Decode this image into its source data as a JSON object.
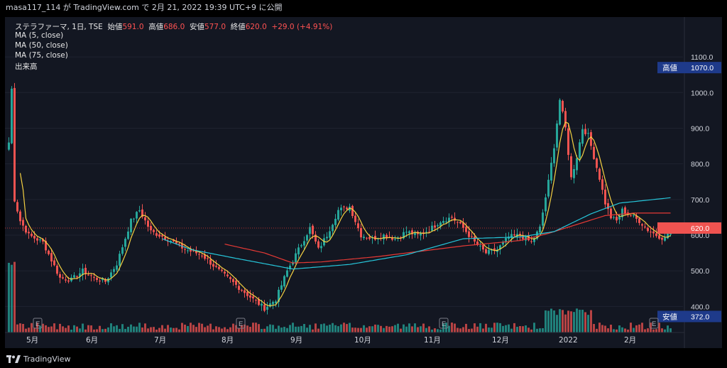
{
  "header": {
    "caption": "masa117_114 が TradingView.com で 2月 21, 2022 19:39 UTC+9 に公開"
  },
  "legend": {
    "symbol": "ステラファーマ, 1日, TSE",
    "open_label": "始値",
    "open": "591.0",
    "high_label": "高値",
    "high": "686.0",
    "low_label": "安値",
    "low": "577.0",
    "close_label": "終値",
    "close": "620.0",
    "change": "+29.0 (+4.91%)",
    "ma5": "MA (5, close)",
    "ma50": "MA (50, close)",
    "ma75": "MA (75, close)",
    "volume": "出来高"
  },
  "price_labels": {
    "high_label": "高値",
    "high_value": "1070.0",
    "low_label": "安値",
    "low_value": "372.0",
    "last_value": "620.0"
  },
  "footer": {
    "brand": "TradingView"
  },
  "colors": {
    "up": "#26a69a",
    "down": "#ef5350",
    "ma5": "#f5d142",
    "ma50": "#e53935",
    "ma75": "#26c6da",
    "background": "#131722"
  },
  "chart_data": {
    "type": "candlestick",
    "y_axis": {
      "ticks": [
        400,
        500,
        600,
        700,
        800,
        900,
        1000,
        1100
      ],
      "range": [
        355,
        1140
      ]
    },
    "x_axis_labels": [
      "5月",
      "6月",
      "7月",
      "8月",
      "9月",
      "10月",
      "11月",
      "12月",
      "2022",
      "2月"
    ],
    "earnings_markers": [
      "E",
      "E",
      "E",
      "E"
    ],
    "price_anchors": [
      {
        "t": 0,
        "p": 860
      },
      {
        "t": 1,
        "p": 1010
      },
      {
        "t": 2,
        "p": 700
      },
      {
        "t": 4,
        "p": 640
      },
      {
        "t": 7,
        "p": 600
      },
      {
        "t": 12,
        "p": 580
      },
      {
        "t": 18,
        "p": 480
      },
      {
        "t": 22,
        "p": 475
      },
      {
        "t": 26,
        "p": 500
      },
      {
        "t": 30,
        "p": 480
      },
      {
        "t": 34,
        "p": 470
      },
      {
        "t": 38,
        "p": 520
      },
      {
        "t": 43,
        "p": 640
      },
      {
        "t": 46,
        "p": 670
      },
      {
        "t": 50,
        "p": 610
      },
      {
        "t": 56,
        "p": 590
      },
      {
        "t": 62,
        "p": 560
      },
      {
        "t": 68,
        "p": 545
      },
      {
        "t": 74,
        "p": 500
      },
      {
        "t": 80,
        "p": 460
      },
      {
        "t": 86,
        "p": 420
      },
      {
        "t": 90,
        "p": 395
      },
      {
        "t": 94,
        "p": 420
      },
      {
        "t": 98,
        "p": 500
      },
      {
        "t": 102,
        "p": 560
      },
      {
        "t": 106,
        "p": 620
      },
      {
        "t": 109,
        "p": 560
      },
      {
        "t": 112,
        "p": 600
      },
      {
        "t": 116,
        "p": 670
      },
      {
        "t": 120,
        "p": 680
      },
      {
        "t": 124,
        "p": 600
      },
      {
        "t": 128,
        "p": 590
      },
      {
        "t": 132,
        "p": 600
      },
      {
        "t": 136,
        "p": 590
      },
      {
        "t": 140,
        "p": 610
      },
      {
        "t": 144,
        "p": 600
      },
      {
        "t": 148,
        "p": 615
      },
      {
        "t": 152,
        "p": 640
      },
      {
        "t": 156,
        "p": 650
      },
      {
        "t": 160,
        "p": 620
      },
      {
        "t": 164,
        "p": 580
      },
      {
        "t": 168,
        "p": 550
      },
      {
        "t": 172,
        "p": 560
      },
      {
        "t": 176,
        "p": 595
      },
      {
        "t": 180,
        "p": 600
      },
      {
        "t": 184,
        "p": 580
      },
      {
        "t": 187,
        "p": 620
      },
      {
        "t": 190,
        "p": 750
      },
      {
        "t": 192,
        "p": 850
      },
      {
        "t": 194,
        "p": 980
      },
      {
        "t": 196,
        "p": 900
      },
      {
        "t": 198,
        "p": 760
      },
      {
        "t": 200,
        "p": 820
      },
      {
        "t": 202,
        "p": 900
      },
      {
        "t": 204,
        "p": 880
      },
      {
        "t": 206,
        "p": 820
      },
      {
        "t": 208,
        "p": 760
      },
      {
        "t": 210,
        "p": 690
      },
      {
        "t": 212,
        "p": 650
      },
      {
        "t": 214,
        "p": 640
      },
      {
        "t": 216,
        "p": 670
      },
      {
        "t": 218,
        "p": 660
      },
      {
        "t": 222,
        "p": 640
      },
      {
        "t": 225,
        "p": 615
      },
      {
        "t": 228,
        "p": 600
      },
      {
        "t": 231,
        "p": 590
      },
      {
        "t": 233,
        "p": 620
      }
    ],
    "ma50_path": [
      {
        "t": 76,
        "p": 575
      },
      {
        "t": 90,
        "p": 550
      },
      {
        "t": 100,
        "p": 522
      },
      {
        "t": 110,
        "p": 525
      },
      {
        "t": 130,
        "p": 540
      },
      {
        "t": 160,
        "p": 570
      },
      {
        "t": 180,
        "p": 585
      },
      {
        "t": 190,
        "p": 605
      },
      {
        "t": 200,
        "p": 630
      },
      {
        "t": 210,
        "p": 655
      },
      {
        "t": 220,
        "p": 662
      },
      {
        "t": 233,
        "p": 662
      }
    ],
    "ma75_path": [
      {
        "t": 54,
        "p": 590
      },
      {
        "t": 64,
        "p": 560
      },
      {
        "t": 80,
        "p": 535
      },
      {
        "t": 90,
        "p": 520
      },
      {
        "t": 100,
        "p": 505
      },
      {
        "t": 120,
        "p": 518
      },
      {
        "t": 140,
        "p": 545
      },
      {
        "t": 160,
        "p": 590
      },
      {
        "t": 180,
        "p": 595
      },
      {
        "t": 192,
        "p": 610
      },
      {
        "t": 205,
        "p": 660
      },
      {
        "t": 215,
        "p": 690
      },
      {
        "t": 233,
        "p": 705
      }
    ]
  }
}
